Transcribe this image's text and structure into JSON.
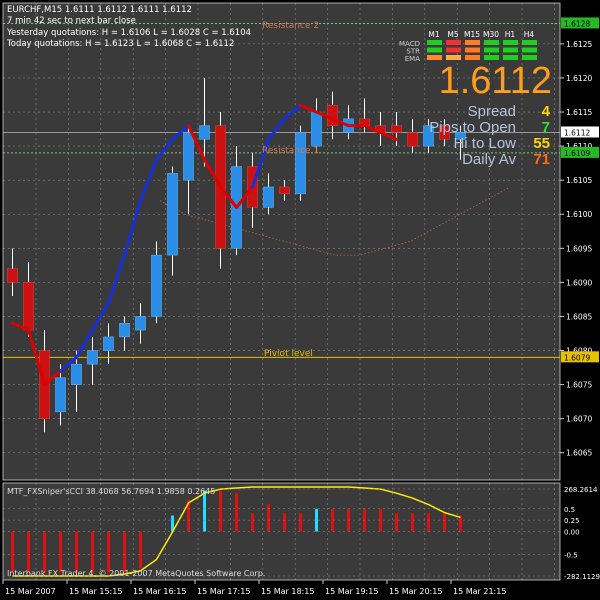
{
  "colors": {
    "background": "#000000",
    "chart_bg": "#3a3a3a",
    "grid": "#8a8a8a",
    "frame": "#cccccc",
    "bull": "#2a8ee8",
    "bear": "#cc1111",
    "wick": "#ffffff",
    "ma_up": "#1530d8",
    "ma_down": "#e00000",
    "resistance": "#7fc97f",
    "pivot": "#e6c200",
    "price_line": "#bbbbbb",
    "mid_band": "#c8643c",
    "price_label_bg": "#22bb22",
    "cci_hist": "#e01010",
    "cci_line": "#ffee00",
    "cci_cyan": "#22ddff"
  },
  "header": {
    "symbol_line": "EURCHF,M15  1.6111 1.6112 1.6111 1.6112",
    "next_bar": "7 min 42 sec to next bar close",
    "yesterday": "Yesterday quotations:  H = 1.6106  L = 1.6028  C = 1.6104",
    "today": "Today quotations:      H = 1.6123  L = 1.6068  C = 1.6112"
  },
  "levels": {
    "resistance_2": "Resistance 2",
    "resistance_1": "Resistance 1",
    "pivot": "Piviot level"
  },
  "panel": {
    "price": "1.6112",
    "rows": [
      {
        "label": "Spread",
        "value": "4",
        "color": "#ffd700"
      },
      {
        "label": "Pips to Open",
        "value": "7",
        "color": "#33dd33"
      },
      {
        "label": "Hi to Low",
        "value": "55",
        "color": "#ffd700"
      },
      {
        "label": "Daily Av",
        "value": "71",
        "color": "#ff6a1a"
      }
    ],
    "timeframes": [
      "M1",
      "M5",
      "M15",
      "M30",
      "H1",
      "H4"
    ],
    "indicators": [
      "MACD",
      "STR",
      "EMA"
    ],
    "cells": [
      [
        "#22cc22",
        "#ee3333",
        "#ff7a2a",
        "#22cc22",
        "#22cc22",
        "#22cc22"
      ],
      [
        "#22cc22",
        "#ee3333",
        "#ff7a2a",
        "#22cc22",
        "#22cc22",
        "#22cc22"
      ],
      [
        "#ff8833",
        "#ffaa44",
        "#ff7a2a",
        "#22cc22",
        "#22cc22",
        "#22cc22"
      ]
    ]
  },
  "price_axis": {
    "ticks": [
      "1.6125",
      "1.6120",
      "1.6115",
      "1.6110",
      "1.6105",
      "1.6100",
      "1.6095",
      "1.6090",
      "1.6085",
      "1.6080",
      "1.6075",
      "1.6070",
      "1.6065"
    ],
    "labels": [
      {
        "text": "1.6128",
        "value": 1.6128,
        "kind": "green"
      },
      {
        "text": "1.6112",
        "value": 1.6112,
        "kind": "white"
      },
      {
        "text": "1.6109",
        "value": 1.6109,
        "kind": "green"
      },
      {
        "text": "1.6079",
        "value": 1.6079,
        "kind": "yellow"
      }
    ]
  },
  "time_axis": [
    "15 Mar 2007",
    "15 Mar 15:15",
    "15 Mar 16:15",
    "15 Mar 17:15",
    "15 Mar 18:15",
    "15 Mar 19:15",
    "15 Mar 20:15",
    "15 Mar 21:15"
  ],
  "indicator": {
    "label": "MTF_FXSniper'sCCI  38.4068 56.7694 1.9858 0.2645",
    "ticks": [
      "268.2614",
      "0.5",
      "0.25",
      "0.00",
      "-0.5",
      "-282.1129"
    ],
    "copyright": "Interbank FX Trader 4, © 2001-2007 MetaQuotes Software Corp."
  },
  "chart_data": {
    "type": "candlestick",
    "symbol": "EURCHF",
    "timeframe": "M15",
    "ylim": [
      1.6061,
      1.6131
    ],
    "levels": {
      "resistance_2": 1.6128,
      "resistance_1": 1.6109,
      "pivot": 1.6079,
      "current": 1.6112
    },
    "candles": [
      {
        "o": 1.6092,
        "h": 1.6095,
        "l": 1.6088,
        "c": 1.609
      },
      {
        "o": 1.609,
        "h": 1.6093,
        "l": 1.6082,
        "c": 1.6083
      },
      {
        "o": 1.608,
        "h": 1.6083,
        "l": 1.6068,
        "c": 1.607
      },
      {
        "o": 1.6071,
        "h": 1.6078,
        "l": 1.6069,
        "c": 1.6076
      },
      {
        "o": 1.6075,
        "h": 1.608,
        "l": 1.6071,
        "c": 1.6078
      },
      {
        "o": 1.6078,
        "h": 1.6082,
        "l": 1.6075,
        "c": 1.608
      },
      {
        "o": 1.608,
        "h": 1.6084,
        "l": 1.6078,
        "c": 1.6082
      },
      {
        "o": 1.6082,
        "h": 1.6085,
        "l": 1.608,
        "c": 1.6084
      },
      {
        "o": 1.6083,
        "h": 1.6087,
        "l": 1.6081,
        "c": 1.6085
      },
      {
        "o": 1.6085,
        "h": 1.6096,
        "l": 1.6084,
        "c": 1.6094
      },
      {
        "o": 1.6094,
        "h": 1.6107,
        "l": 1.6091,
        "c": 1.6106
      },
      {
        "o": 1.6105,
        "h": 1.6113,
        "l": 1.61,
        "c": 1.6112
      },
      {
        "o": 1.6111,
        "h": 1.612,
        "l": 1.6107,
        "c": 1.6113
      },
      {
        "o": 1.6113,
        "h": 1.6115,
        "l": 1.6092,
        "c": 1.6095
      },
      {
        "o": 1.6095,
        "h": 1.611,
        "l": 1.6094,
        "c": 1.6107
      },
      {
        "o": 1.6107,
        "h": 1.6109,
        "l": 1.6098,
        "c": 1.6101
      },
      {
        "o": 1.6101,
        "h": 1.6106,
        "l": 1.61,
        "c": 1.6104
      },
      {
        "o": 1.6104,
        "h": 1.6105,
        "l": 1.6102,
        "c": 1.6103
      },
      {
        "o": 1.6103,
        "h": 1.6113,
        "l": 1.6102,
        "c": 1.6112
      },
      {
        "o": 1.611,
        "h": 1.6117,
        "l": 1.6109,
        "c": 1.6115
      },
      {
        "o": 1.6116,
        "h": 1.6118,
        "l": 1.6111,
        "c": 1.6113
      },
      {
        "o": 1.6112,
        "h": 1.6116,
        "l": 1.6111,
        "c": 1.6114
      },
      {
        "o": 1.6114,
        "h": 1.6117,
        "l": 1.6112,
        "c": 1.6113
      },
      {
        "o": 1.6113,
        "h": 1.6115,
        "l": 1.611,
        "c": 1.6112
      },
      {
        "o": 1.6113,
        "h": 1.6115,
        "l": 1.611,
        "c": 1.6112
      },
      {
        "o": 1.6112,
        "h": 1.6114,
        "l": 1.6109,
        "c": 1.611
      },
      {
        "o": 1.611,
        "h": 1.6114,
        "l": 1.6109,
        "c": 1.6113
      },
      {
        "o": 1.6113,
        "h": 1.6114,
        "l": 1.611,
        "c": 1.6111
      },
      {
        "o": 1.6111,
        "h": 1.6113,
        "l": 1.6108,
        "c": 1.6112
      }
    ],
    "ma": [
      1.6084,
      1.6083,
      1.6075,
      1.6077,
      1.6079,
      1.6083,
      1.6087,
      1.6094,
      1.6102,
      1.6108,
      1.6111,
      1.6113,
      1.6108,
      1.6104,
      1.6101,
      1.6104,
      1.6111,
      1.6114,
      1.6116,
      1.6115,
      1.6114,
      1.6113,
      1.6113,
      1.6112,
      1.6111
    ],
    "ma_trend": [
      "down",
      "down",
      "down",
      "up",
      "up",
      "up",
      "up",
      "up",
      "up",
      "up",
      "up",
      "down",
      "down",
      "down",
      "down",
      "up",
      "up",
      "up",
      "down",
      "down",
      "down",
      "down",
      "down",
      "down",
      "down"
    ],
    "mid_band": [
      1.6102,
      1.61,
      1.6099,
      1.6098,
      1.6097,
      1.6096,
      1.6095,
      1.6094,
      1.6094,
      1.6095,
      1.6096,
      1.6098,
      1.61,
      1.6102,
      1.6104
    ],
    "cci_hist": [
      -0.9,
      -0.9,
      -0.9,
      -0.9,
      -0.9,
      -0.9,
      -0.9,
      -0.9,
      -0.8,
      0.0,
      0.35,
      0.7,
      0.9,
      0.9,
      0.85,
      0.4,
      0.6,
      0.4,
      0.4,
      0.5,
      0.5,
      0.5,
      0.5,
      0.5,
      0.4,
      0.4,
      0.4,
      0.4,
      0.35
    ],
    "cci_line": [
      -282,
      -282,
      -282,
      -282,
      -282,
      -282,
      -282,
      -270,
      -250,
      -180,
      -10,
      170,
      230,
      255,
      262,
      268,
      268,
      268,
      268,
      268,
      268,
      268,
      262,
      255,
      230,
      200,
      160,
      110,
      80
    ],
    "cci_ylim": [
      -282.1129,
      268.2614
    ]
  }
}
